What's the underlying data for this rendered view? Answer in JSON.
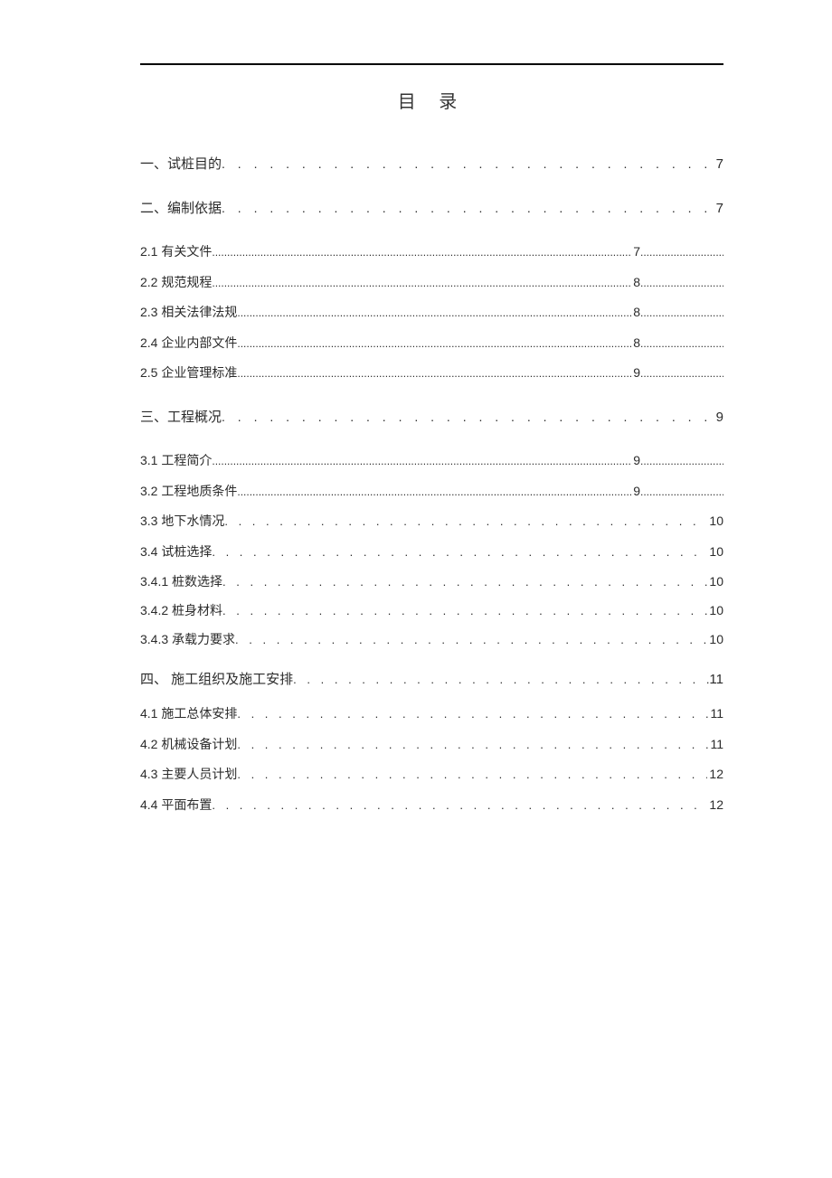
{
  "title": "目 录",
  "leaders": {
    "heavy": ". . . . . . . . . . . . . . . . . . . . . . . . . . . . . . . . . . . . . . . . . . . . . . . . . . . . . . . . . . . . . . . . . . . . . . . . . . . . . . . . . . . . . . . . . . . . . . . . . . . . . . . . . . . . . . . . . . . . . . . . . . . . . . . . . . . . . . . . . . . . . . . . . .",
    "fine": "............................................................................................................................................................................................................................................................................",
    "tailHeavy": ". . . . . . . .",
    "tailFine": "................................................"
  },
  "toc": {
    "s1": {
      "label": "一、试桩目的 ",
      "page": "7"
    },
    "s2": {
      "label": "二、编制依据 ",
      "page": "7"
    },
    "s2_1": {
      "label": "2.1 有关文件 ",
      "page": "7"
    },
    "s2_2": {
      "label": "2.2 规范规程 ",
      "page": "8"
    },
    "s2_3": {
      "label": "2.3 相关法律法规 ",
      "page": "8"
    },
    "s2_4": {
      "label": "2.4 企业内部文件 ",
      "page": "8"
    },
    "s2_5": {
      "label": "2.5 企业管理标准 ",
      "page": "9"
    },
    "s3": {
      "label": "三、工程概况 ",
      "page": "9"
    },
    "s3_1": {
      "label": "3.1 工程简介 ",
      "page": "9"
    },
    "s3_2": {
      "label": "3.2 工程地质条件 ",
      "page": "9"
    },
    "s3_3": {
      "label": "3.3 地下水情况 ",
      "page": "10"
    },
    "s3_4": {
      "label": "3.4 试桩选择 ",
      "page": "10"
    },
    "s3_4_1": {
      "label": "3.4.1 桩数选择",
      "page": "10"
    },
    "s3_4_2": {
      "label": "3.4.2 桩身材料",
      "page": "10"
    },
    "s3_4_3": {
      "label": "3.4.3 承载力要求",
      "page": "10"
    },
    "s4": {
      "label": "四、 施工组织及施工安排 ",
      "page": "11"
    },
    "s4_1": {
      "label": "4.1 施工总体安排",
      "page": "11"
    },
    "s4_2": {
      "label": "4.2 机械设备计划",
      "page": "11"
    },
    "s4_3": {
      "label": "4.3 主要人员计划",
      "page": "12"
    },
    "s4_4": {
      "label": "4.4 平面布置 ",
      "page": "12"
    }
  }
}
